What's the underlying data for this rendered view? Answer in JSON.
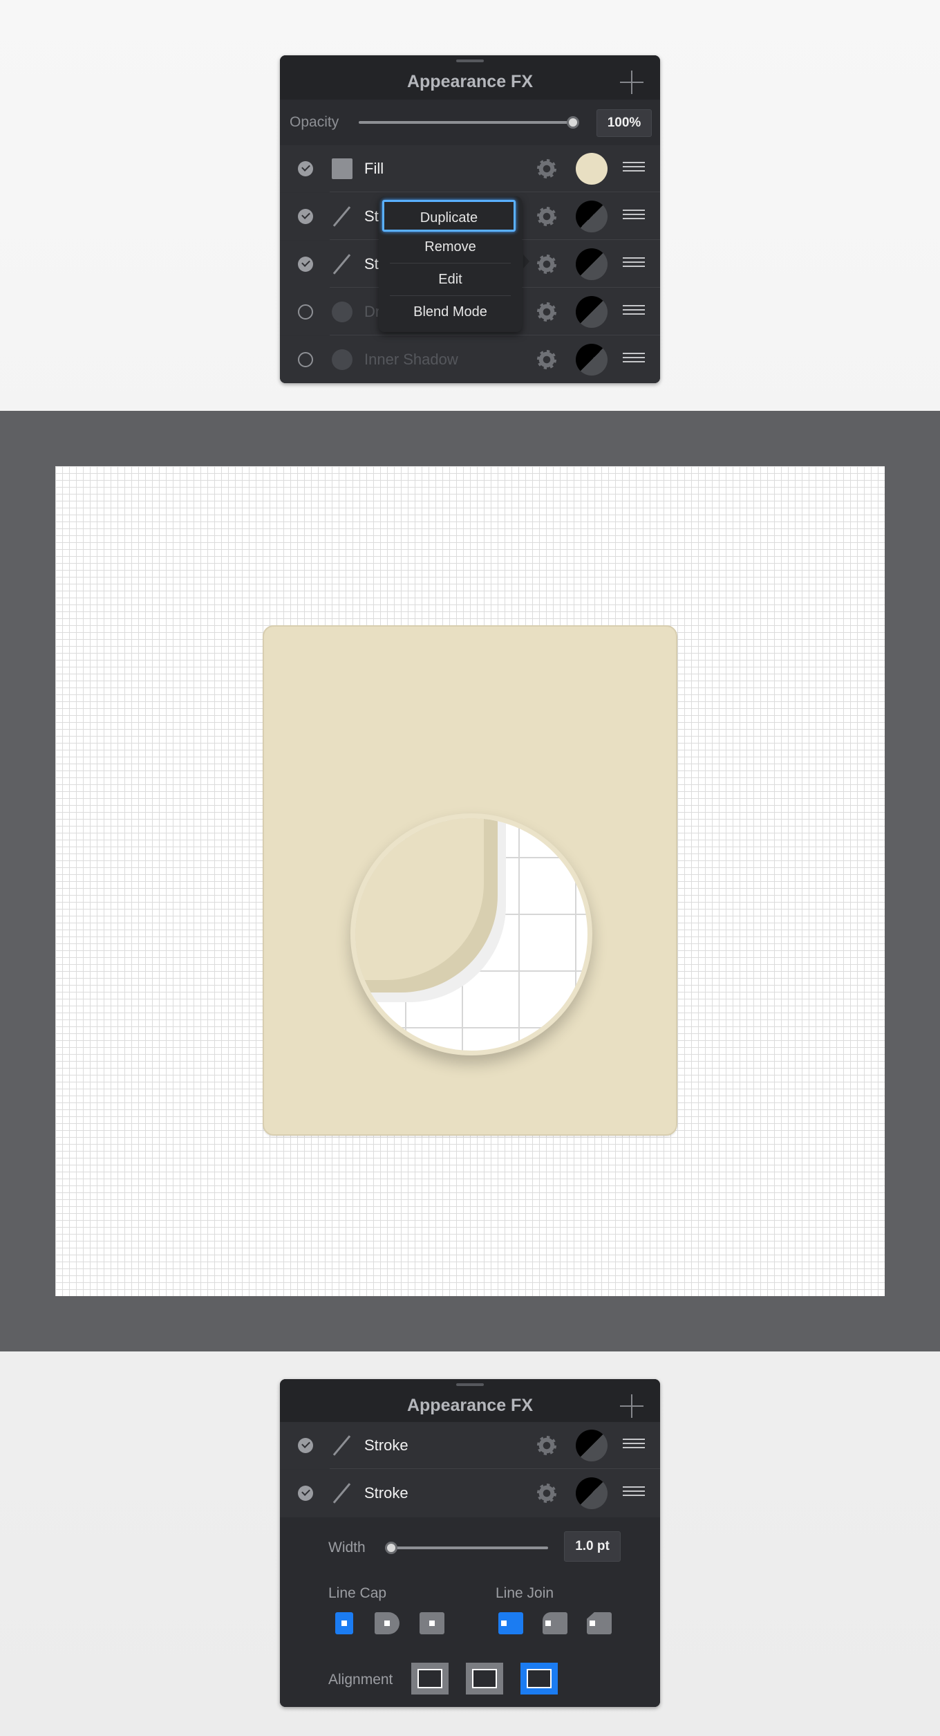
{
  "panel1": {
    "title": "Appearance FX",
    "opacity_label": "Opacity",
    "opacity_value": "100%",
    "opacity_level": 1.0,
    "rows": [
      {
        "label": "Fill",
        "enabled": true,
        "type": "fill",
        "swatch": "#e8dfc2"
      },
      {
        "label": "St",
        "enabled": true,
        "type": "stroke",
        "swatch": "split"
      },
      {
        "label": "St",
        "enabled": true,
        "type": "stroke",
        "swatch": "split"
      },
      {
        "label": "Dr",
        "enabled": false,
        "type": "shadow",
        "swatch": "black"
      },
      {
        "label": "Inner Shadow",
        "enabled": false,
        "type": "shadow",
        "swatch": "black"
      }
    ],
    "context_menu": [
      "Duplicate",
      "Remove",
      "Edit",
      "Blend Mode"
    ]
  },
  "panel2": {
    "title": "Appearance FX",
    "rows": [
      {
        "label": "Stroke",
        "enabled": true
      },
      {
        "label": "Stroke",
        "enabled": true
      }
    ],
    "width_label": "Width",
    "width_value": "1.0 pt",
    "line_cap_label": "Line Cap",
    "line_join_label": "Line Join",
    "alignment_label": "Alignment"
  },
  "colors": {
    "accent": "#1b7cf2",
    "card_fill": "#e8dfc2",
    "panel_bg": "#2f3034"
  }
}
